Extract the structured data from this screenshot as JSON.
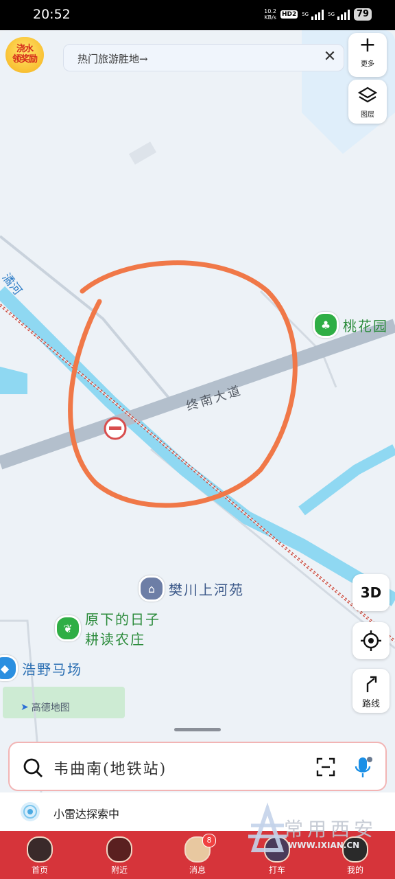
{
  "status_bar": {
    "time": "20:52",
    "net_speed_value": "10.2",
    "net_speed_unit": "KB/s",
    "hd_badge": "HD2",
    "signal1": "5G",
    "signal2": "5G",
    "battery": "79"
  },
  "promo": {
    "line1": "浇水",
    "line2": "领奖励"
  },
  "hint_bar": {
    "text": "热门旅游胜地→"
  },
  "map_controls": {
    "more_label": "更多",
    "layers_label": "图层",
    "three_d_label": "3D",
    "route_label": "路线"
  },
  "map": {
    "road_name": "终南大道",
    "river_name": "潏河",
    "pois": [
      {
        "name": "桃花园",
        "kind": "park",
        "color": "#2fae45"
      },
      {
        "name": "樊川上河苑",
        "kind": "residential",
        "color": "#6d7ea6"
      },
      {
        "name": "原下的日子",
        "name2": "耕读农庄",
        "kind": "farm",
        "color": "#2fae45"
      },
      {
        "name": "浩野马场",
        "kind": "venue",
        "color": "#2b8fe0"
      }
    ],
    "watermark": "高德地图",
    "annotation_color": "#f07848",
    "river_color": "#8fd8f2",
    "road_color": "#b3bfcc",
    "railway_color": "#c94b3f"
  },
  "search": {
    "placeholder": "韦曲南(地铁站)"
  },
  "radar": {
    "text": "小雷达探索中"
  },
  "tabs": [
    {
      "label": "首页"
    },
    {
      "label": "附近"
    },
    {
      "label": "消息",
      "badge": "8"
    },
    {
      "label": "打车"
    },
    {
      "label": "我的"
    }
  ],
  "watermark_site": {
    "name": "常用西安",
    "url": "WWW.IXIAN.CN"
  }
}
